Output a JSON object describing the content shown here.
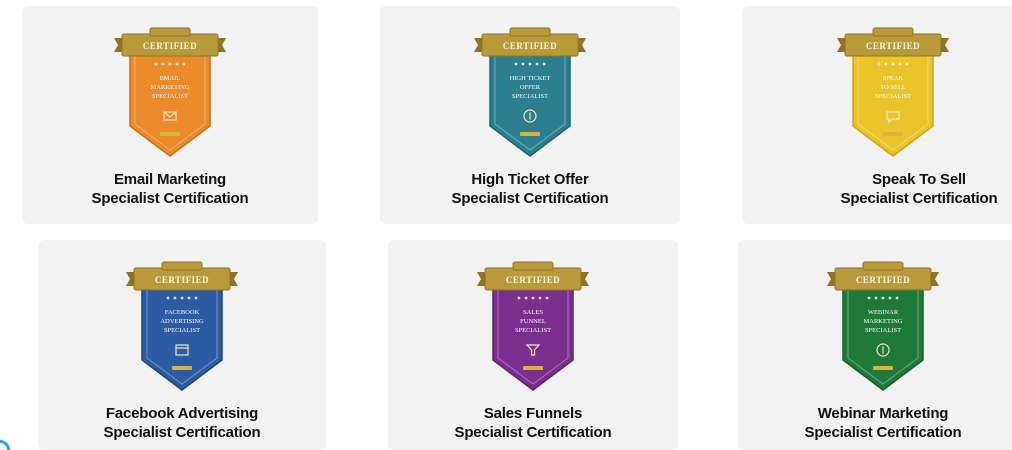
{
  "cards": [
    {
      "badge_lines": [
        "EMAIL",
        "MARKETING",
        "SPECIALIST"
      ],
      "title_line1": "Email Marketing",
      "title_line2": "Specialist Certification",
      "shield_color": "#ec8a2c",
      "shield_dark": "#c9701c",
      "icon": "envelope-icon"
    },
    {
      "badge_lines": [
        "HIGH TICKET",
        "OFFER",
        "SPECIALIST"
      ],
      "title_line1": "High Ticket Offer",
      "title_line2": "Specialist Certification",
      "shield_color": "#2b7f8f",
      "shield_dark": "#1f6472",
      "icon": "dollar-coin-icon"
    },
    {
      "badge_lines": [
        "SPEAK",
        "TO SELL",
        "SPECIALIST"
      ],
      "title_line1": "Speak To Sell",
      "title_line2": "Specialist Certification",
      "shield_color": "#e9c52a",
      "shield_dark": "#c9a617",
      "icon": "speech-bubble-icon"
    },
    {
      "badge_lines": [
        "FACEBOOK",
        "ADVERTISING",
        "SPECIALIST"
      ],
      "title_line1": "Facebook Advertising",
      "title_line2": "Specialist Certification",
      "shield_color": "#2c5aa3",
      "shield_dark": "#1f447f",
      "icon": "ad-window-icon"
    },
    {
      "badge_lines": [
        "SALES",
        "FUNNEL",
        "SPECIALIST"
      ],
      "title_line1": "Sales Funnels",
      "title_line2": "Specialist Certification",
      "shield_color": "#7a2f8f",
      "shield_dark": "#5e2270",
      "icon": "funnel-icon"
    },
    {
      "badge_lines": [
        "WEBINAR",
        "MARKETING",
        "SPECIALIST"
      ],
      "title_line1": "Webinar Marketing",
      "title_line2": "Specialist Certification",
      "shield_color": "#1f7a3a",
      "shield_dark": "#16602c",
      "icon": "play-coin-icon"
    }
  ],
  "ribbon_text": "CERTIFIED",
  "ribbon_color": "#b99a3a",
  "ribbon_dark": "#8e7326",
  "footer_stamp_color": "#d9b43a"
}
